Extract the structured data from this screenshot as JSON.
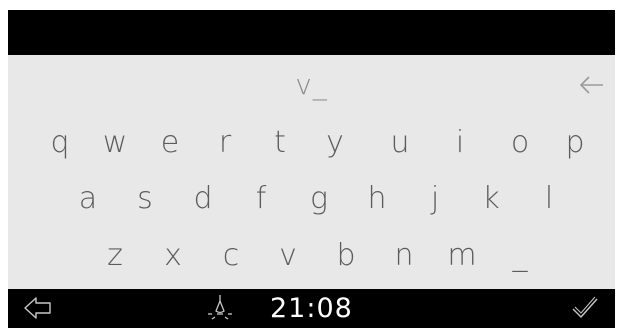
{
  "entry": {
    "text": "v_"
  },
  "keyboard": {
    "row1": [
      "q",
      "w",
      "e",
      "r",
      "t",
      "y",
      "u",
      "i",
      "o",
      "p"
    ],
    "row2": [
      "a",
      "s",
      "d",
      "f",
      "g",
      "h",
      "j",
      "k",
      "l"
    ],
    "row3": [
      "z",
      "x",
      "c",
      "v",
      "b",
      "n",
      "m",
      "_"
    ]
  },
  "status_bar": {
    "time": "21:08"
  },
  "icons": {
    "backspace": "backspace-arrow-icon",
    "back": "back-arrow-icon",
    "brightness": "lightbulb-icon",
    "confirm": "checkmark-icon"
  },
  "colors": {
    "bars": "#000000",
    "panel": "#e8e8e8",
    "keys": "#5c5c5c",
    "entry": "#8a8a8a",
    "icons": "#cccccc"
  }
}
